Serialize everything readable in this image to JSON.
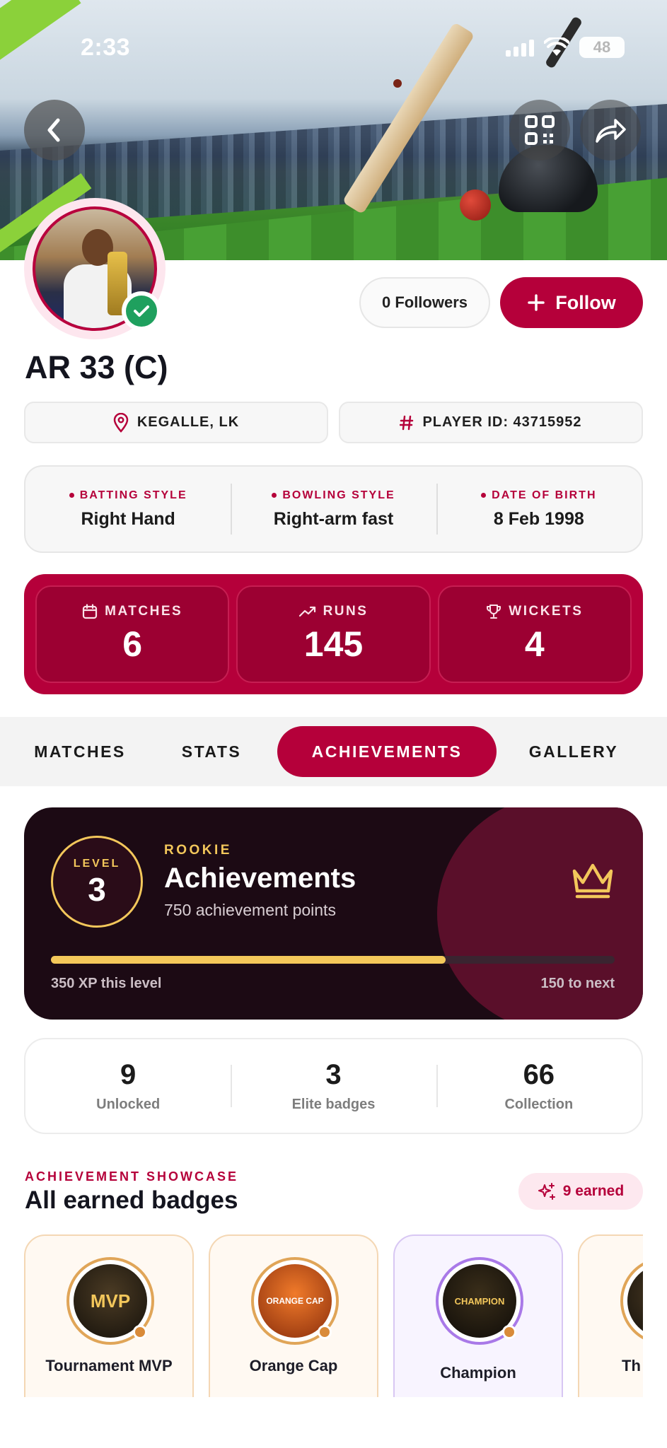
{
  "status_bar": {
    "time": "2:33",
    "battery": "48"
  },
  "header": {
    "back_icon": "chevron-left-icon",
    "qr_icon": "qr-code-icon",
    "share_icon": "share-arrow-icon"
  },
  "profile": {
    "name": "AR 33 (C)",
    "followers_label": "0 Followers",
    "follow_label": "Follow",
    "location": "KEGALLE, LK",
    "player_id": "PLAYER ID: 43715952"
  },
  "info": [
    {
      "label": "BATTING STYLE",
      "value": "Right Hand"
    },
    {
      "label": "BOWLING STYLE",
      "value": "Right-arm fast"
    },
    {
      "label": "DATE OF BIRTH",
      "value": "8 Feb 1998"
    }
  ],
  "stats": [
    {
      "label": "MATCHES",
      "value": "6",
      "icon": "calendar-icon"
    },
    {
      "label": "RUNS",
      "value": "145",
      "icon": "trending-up-icon"
    },
    {
      "label": "WICKETS",
      "value": "4",
      "icon": "trophy-icon"
    }
  ],
  "tabs": [
    "MATCHES",
    "STATS",
    "ACHIEVEMENTS",
    "GALLERY"
  ],
  "active_tab": "ACHIEVEMENTS",
  "level": {
    "level_label": "LEVEL",
    "level_number": "3",
    "rank": "ROOKIE",
    "title": "Achievements",
    "points": "750 achievement points",
    "progress_fraction": 0.7,
    "xp_this_level": "350 XP this level",
    "to_next": "150 to next"
  },
  "counts": [
    {
      "value": "9",
      "label": "Unlocked"
    },
    {
      "value": "3",
      "label": "Elite badges"
    },
    {
      "value": "66",
      "label": "Collection"
    }
  ],
  "showcase": {
    "eyebrow": "ACHIEVEMENT SHOWCASE",
    "title": "All earned badges",
    "earned": "9 earned"
  },
  "badges": [
    {
      "name": "Tournament MVP",
      "medal_text": "MVP"
    },
    {
      "name": "Orange Cap",
      "medal_text": "ORANGE CAP"
    },
    {
      "name": "Champion",
      "medal_text": "CHAMPION"
    },
    {
      "name": "Th",
      "medal_text": ""
    }
  ],
  "colors": {
    "brand": "#b5003a",
    "gold": "#f3c75b",
    "dark_card": "#1c0a14",
    "verified": "#1fa05e"
  }
}
